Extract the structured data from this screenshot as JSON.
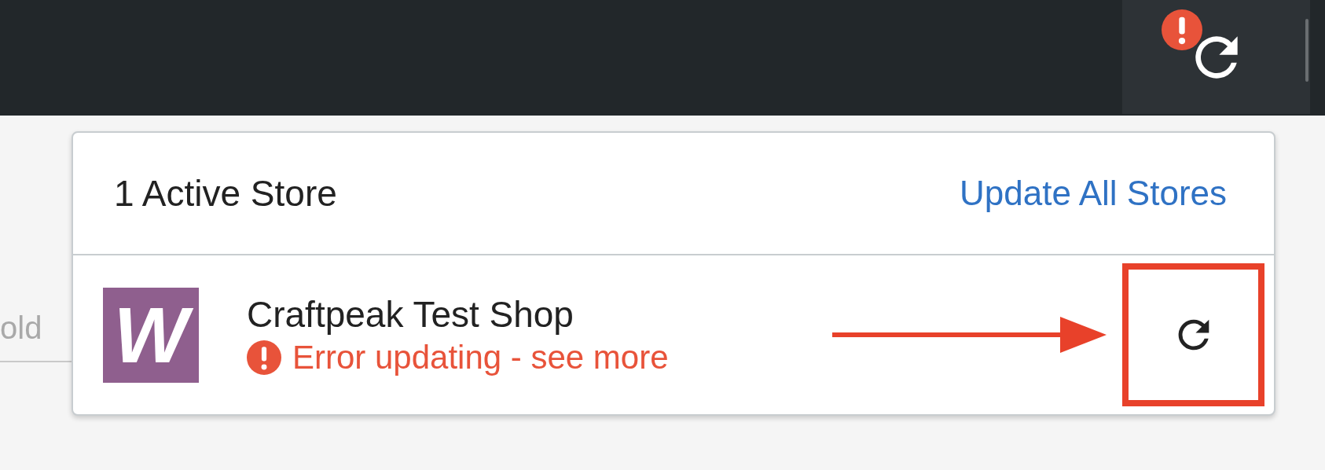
{
  "top_bar": {
    "sync_button": {
      "has_error": true
    }
  },
  "background_field": {
    "value": "old"
  },
  "popup": {
    "title": "1 Active Store",
    "update_all": "Update All Stores",
    "stores": [
      {
        "logo_text": "W",
        "name": "Craftpeak Test Shop",
        "has_error": true,
        "status_text": "Error updating - see more",
        "highlighted": true
      }
    ]
  }
}
